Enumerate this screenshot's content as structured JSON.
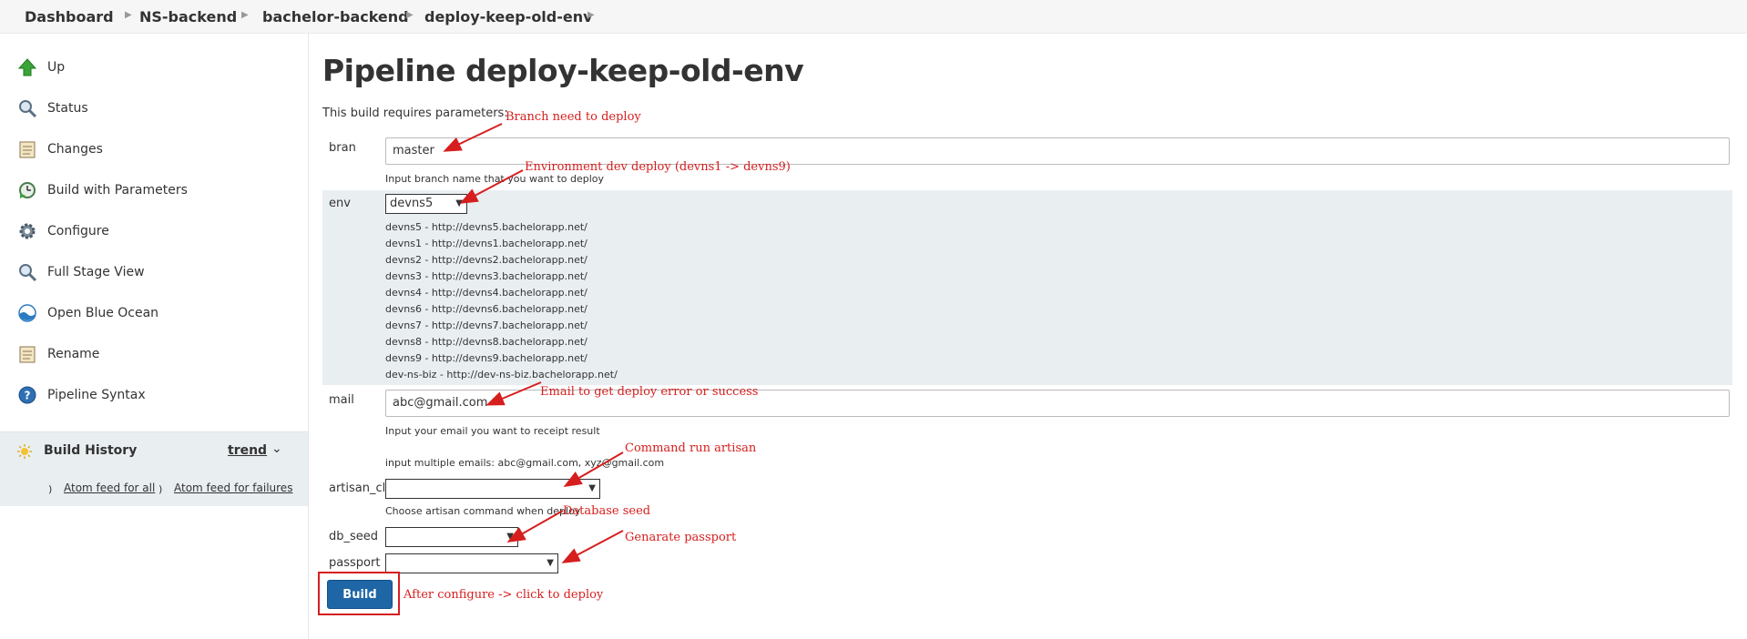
{
  "breadcrumb": [
    "Dashboard",
    "NS-backend",
    "bachelor-backend",
    "deploy-keep-old-env"
  ],
  "sidebar": {
    "items": [
      {
        "label": "Up",
        "icon": "up-arrow-icon"
      },
      {
        "label": "Status",
        "icon": "magnifier-icon"
      },
      {
        "label": "Changes",
        "icon": "notepad-icon"
      },
      {
        "label": "Build with Parameters",
        "icon": "clock-play-icon"
      },
      {
        "label": "Configure",
        "icon": "gear-icon"
      },
      {
        "label": "Full Stage View",
        "icon": "magnifier-icon"
      },
      {
        "label": "Open Blue Ocean",
        "icon": "blue-ocean-icon"
      },
      {
        "label": "Rename",
        "icon": "notepad-icon"
      },
      {
        "label": "Pipeline Syntax",
        "icon": "help-icon"
      }
    ],
    "build_history": {
      "title": "Build History",
      "trend": "trend",
      "atom_all": "Atom feed for all",
      "atom_failures": "Atom feed for failures"
    }
  },
  "main": {
    "title": "Pipeline deploy-keep-old-env",
    "intro": "This build requires parameters:",
    "params": {
      "bran": {
        "label": "bran",
        "value": "master",
        "help": "Input branch name that you want to deploy"
      },
      "env": {
        "label": "env",
        "selected": "devns5",
        "lines": [
          "devns5 - http://devns5.bachelorapp.net/",
          "devns1 - http://devns1.bachelorapp.net/",
          "devns2 - http://devns2.bachelorapp.net/",
          "devns3 - http://devns3.bachelorapp.net/",
          "devns4 - http://devns4.bachelorapp.net/",
          "devns6 - http://devns6.bachelorapp.net/",
          "devns7 - http://devns7.bachelorapp.net/",
          "devns8 - http://devns8.bachelorapp.net/",
          "devns9 - http://devns9.bachelorapp.net/",
          "dev-ns-biz - http://dev-ns-biz.bachelorapp.net/"
        ]
      },
      "mail": {
        "label": "mail",
        "value": "abc@gmail.com",
        "help1": "Input your email you want to receipt result",
        "help2": "input multiple emails: abc@gmail.com, xyz@gmail.com"
      },
      "artisan_cli": {
        "label": "artisan_cli",
        "value": "",
        "help": "Choose artisan command when deploy"
      },
      "db_seed": {
        "label": "db_seed",
        "value": ""
      },
      "passport": {
        "label": "passport",
        "value": ""
      }
    },
    "build_label": "Build"
  },
  "annotations": {
    "branch": "Branch need to deploy",
    "env": "Environment dev deploy (devns1 -> devns9)",
    "mail": "Email to get deploy error or success",
    "artisan": "Command run artisan",
    "db_seed": "Database seed",
    "passport": "Genarate passport",
    "build": "After configure -> click to deploy"
  },
  "colors": {
    "annotation": "#d61e1e",
    "build_button": "#1f66a6",
    "env_block": "#e9eef1"
  }
}
